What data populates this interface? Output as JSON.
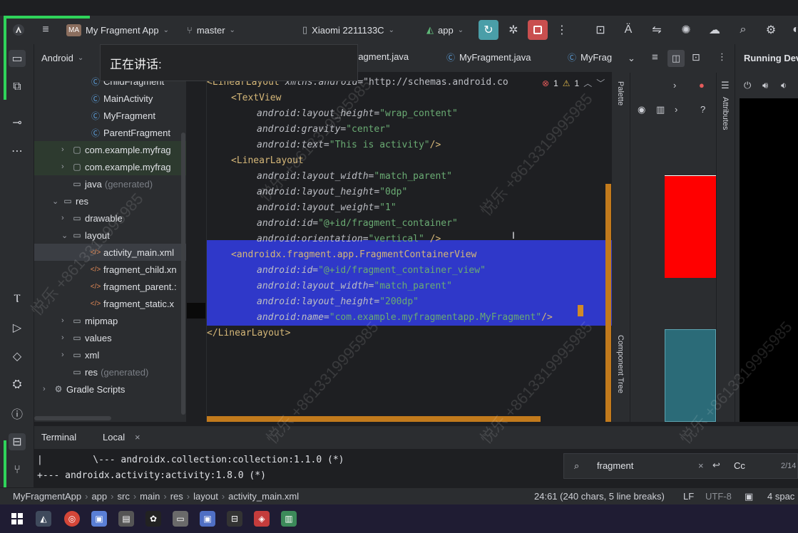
{
  "overlay": {
    "speaking": "正在讲话:"
  },
  "toolbar": {
    "project_badge": "MA",
    "project_name": "My Fragment App",
    "branch": "master",
    "device": "Xiaomi 2211133C",
    "run_config": "app"
  },
  "project_panel": {
    "view_mode": "Android",
    "rows": [
      {
        "label": "ChildFragment",
        "icon": "class",
        "indent": 4
      },
      {
        "label": "MainActivity",
        "icon": "class",
        "indent": 4
      },
      {
        "label": "MyFragment",
        "icon": "class",
        "indent": 4
      },
      {
        "label": "ParentFragment",
        "icon": "class",
        "indent": 4
      },
      {
        "label": "com.example.myfrag",
        "icon": "package",
        "indent": 2,
        "expander": "›"
      },
      {
        "label": "com.example.myfrag",
        "icon": "package",
        "indent": 2,
        "expander": "›"
      },
      {
        "label": "java",
        "suffix": "(generated)",
        "icon": "folder",
        "indent": 2
      },
      {
        "label": "res",
        "icon": "folder",
        "indent": 1,
        "expander": "⌄"
      },
      {
        "label": "drawable",
        "icon": "folder",
        "indent": 2,
        "expander": "›"
      },
      {
        "label": "layout",
        "icon": "folder",
        "indent": 2,
        "expander": "⌄"
      },
      {
        "label": "activity_main.xml",
        "icon": "xml",
        "indent": 4,
        "selected": true
      },
      {
        "label": "fragment_child.xn",
        "icon": "xml",
        "indent": 4
      },
      {
        "label": "fragment_parent.:",
        "icon": "xml",
        "indent": 4
      },
      {
        "label": "fragment_static.x",
        "icon": "xml",
        "indent": 4
      },
      {
        "label": "mipmap",
        "icon": "folder",
        "indent": 2,
        "expander": "›"
      },
      {
        "label": "values",
        "icon": "folder",
        "indent": 2,
        "expander": "›"
      },
      {
        "label": "xml",
        "icon": "folder",
        "indent": 2,
        "expander": "›"
      },
      {
        "label": "res",
        "suffix": "(generated)",
        "icon": "folder",
        "indent": 2
      },
      {
        "label": "Gradle Scripts",
        "icon": "gradle",
        "indent": 0,
        "expander": "›"
      }
    ]
  },
  "editor": {
    "tabs": [
      "ragment.java",
      "MyFragment.java",
      "MyFrag"
    ],
    "inspection": {
      "errors": "1",
      "warnings": "1"
    },
    "lines": [
      {
        "parts": [
          [
            "tag",
            "<LinearLayout "
          ],
          [
            "attr",
            "xmlns:android"
          ],
          [
            "plain",
            "=\"http://schemas.android.co"
          ]
        ],
        "indent": 0
      },
      {
        "parts": [
          [
            "tag",
            "<TextView"
          ]
        ],
        "indent": 1
      },
      {
        "parts": [
          [
            "attr",
            "android:layout_height"
          ],
          [
            "plain",
            "="
          ],
          [
            "val",
            "\"wrap_content\""
          ]
        ],
        "indent": 2
      },
      {
        "parts": [
          [
            "attr",
            "android:gravity"
          ],
          [
            "plain",
            "="
          ],
          [
            "val",
            "\"center\""
          ]
        ],
        "indent": 2
      },
      {
        "parts": [
          [
            "attr",
            "android:text"
          ],
          [
            "plain",
            "="
          ],
          [
            "val",
            "\"This is activity\""
          ],
          [
            "tag",
            "/>"
          ]
        ],
        "indent": 2
      },
      {
        "parts": [
          [
            "tag",
            "<LinearLayout"
          ]
        ],
        "indent": 1
      },
      {
        "parts": [
          [
            "attr",
            "android:layout_width"
          ],
          [
            "plain",
            "="
          ],
          [
            "val",
            "\"match_parent\""
          ]
        ],
        "indent": 2
      },
      {
        "parts": [
          [
            "attr",
            "android:layout_height"
          ],
          [
            "plain",
            "="
          ],
          [
            "val",
            "\"0dp\""
          ]
        ],
        "indent": 2
      },
      {
        "parts": [
          [
            "attr",
            "android:layout_weight"
          ],
          [
            "plain",
            "="
          ],
          [
            "val",
            "\"1\""
          ]
        ],
        "indent": 2
      },
      {
        "parts": [
          [
            "attr",
            "android:id"
          ],
          [
            "plain",
            "="
          ],
          [
            "val",
            "\"@+id/fragment_container\""
          ]
        ],
        "indent": 2
      },
      {
        "parts": [
          [
            "attr",
            "android:orientation"
          ],
          [
            "plain",
            "="
          ],
          [
            "val",
            "\"vertical\""
          ],
          [
            "tag",
            " />"
          ]
        ],
        "indent": 2
      },
      {
        "parts": [
          [
            "tag",
            "<androidx.fragment.app.FragmentContainerView"
          ]
        ],
        "indent": 1,
        "selected": true
      },
      {
        "parts": [
          [
            "attr",
            "android:id"
          ],
          [
            "plain",
            "="
          ],
          [
            "val",
            "\"@+id/fragment_container_view\""
          ]
        ],
        "indent": 2,
        "selected": true
      },
      {
        "parts": [
          [
            "attr",
            "android:layout_width"
          ],
          [
            "plain",
            "="
          ],
          [
            "val",
            "\"match_parent\""
          ]
        ],
        "indent": 2,
        "selected": true
      },
      {
        "parts": [
          [
            "attr",
            "android:layout_height"
          ],
          [
            "plain",
            "="
          ],
          [
            "val",
            "\"200dp\""
          ]
        ],
        "indent": 2,
        "selected": true
      },
      {
        "parts": [
          [
            "attr",
            "android:name"
          ],
          [
            "plain",
            "="
          ],
          [
            "val",
            "\"com.example.myfragmentapp.MyFragment\""
          ],
          [
            "tag",
            "/>"
          ]
        ],
        "indent": 2,
        "selected": true
      },
      {
        "parts": [
          [
            "tag",
            "</LinearLayout>"
          ]
        ],
        "indent": 0
      }
    ]
  },
  "design": {
    "palette_label": "Palette",
    "component_tree_label": "Component Tree",
    "attributes_label": "Attributes",
    "running_devices_label": "Running Dev",
    "help_glyph": "?"
  },
  "terminal": {
    "tab_active": "Terminal",
    "tab_local": "Local",
    "close_glyph": "×",
    "lines": [
      "|         \\--- androidx.collection:collection:1.1.0 (*)",
      "+--- androidx.activity:activity:1.8.0 (*)"
    ],
    "search_value": "fragment",
    "match_case": "Cc",
    "match_count": "2/14"
  },
  "statusbar": {
    "breadcrumb": [
      "MyFragmentApp",
      "app",
      "src",
      "main",
      "res",
      "layout",
      "activity_main.xml"
    ],
    "position": "24:61 (240 chars, 5 line breaks)",
    "line_sep": "LF",
    "encoding": "UTF-8",
    "indent": "4 spac"
  },
  "watermark": {
    "text": "悦乐 +8613319995985"
  },
  "colors": {
    "accent_green": "#2fd35a",
    "selection": "#2f38c9",
    "preview_red": "#ff0000"
  }
}
